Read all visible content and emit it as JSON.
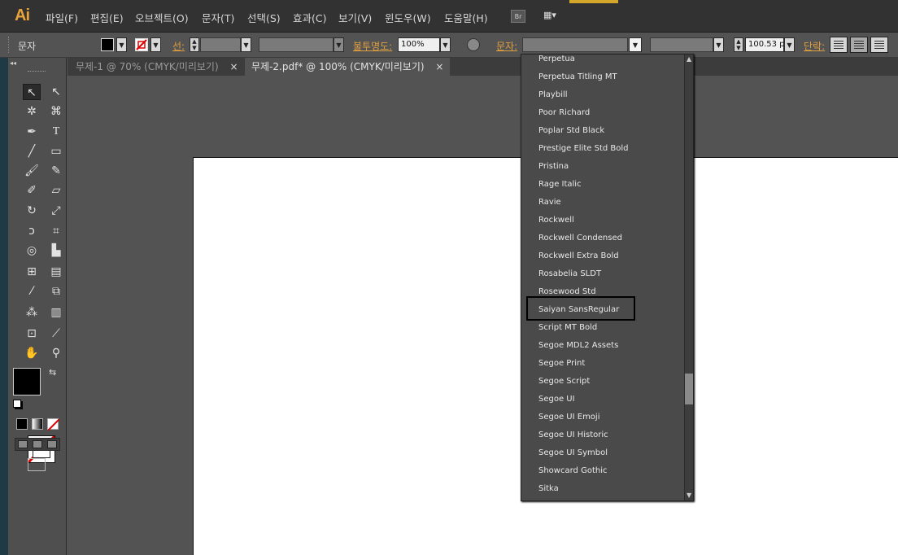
{
  "menubar": {
    "logo": "Ai",
    "items": [
      "파일(F)",
      "편집(E)",
      "오브젝트(O)",
      "문자(T)",
      "선택(S)",
      "효과(C)",
      "보기(V)",
      "윈도우(W)",
      "도움말(H)"
    ],
    "bridge_label": "Br",
    "workspace_label": "▦▾"
  },
  "control": {
    "mode_label": "문자",
    "stroke_label": "선:",
    "opacity_label": "불투명도:",
    "opacity_value": "100%",
    "character_label": "문자:",
    "font_size_value": "100.53 p",
    "paragraph_label": "단락:"
  },
  "tabs": [
    {
      "label": "무제-1 @ 70% (CMYK/미리보기)",
      "close": "×"
    },
    {
      "label": "무제-2.pdf* @ 100% (CMYK/미리보기)",
      "close": "×"
    }
  ],
  "font_list": {
    "items": [
      "Perpetua",
      "Perpetua Titling MT",
      "Playbill",
      "Poor Richard",
      "Poplar Std Black",
      "Prestige Elite Std Bold",
      "Pristina",
      "Rage Italic",
      "Ravie",
      "Rockwell",
      "Rockwell Condensed",
      "Rockwell Extra Bold",
      "Rosabelia SLDT",
      "Rosewood Std",
      "Saiyan SansRegular",
      "Script MT Bold",
      "Segoe MDL2 Assets",
      "Segoe Print",
      "Segoe Script",
      "Segoe UI",
      "Segoe UI Emoji",
      "Segoe UI Historic",
      "Segoe UI Symbol",
      "Showcard Gothic",
      "Sitka"
    ],
    "highlighted": "Saiyan SansRegular"
  },
  "toolbox": {
    "collapse_label": "◂◂",
    "swap_label": "⇆"
  },
  "colors": {
    "accent": "#e8a43a",
    "panel": "#535353",
    "menubar": "#323232"
  }
}
